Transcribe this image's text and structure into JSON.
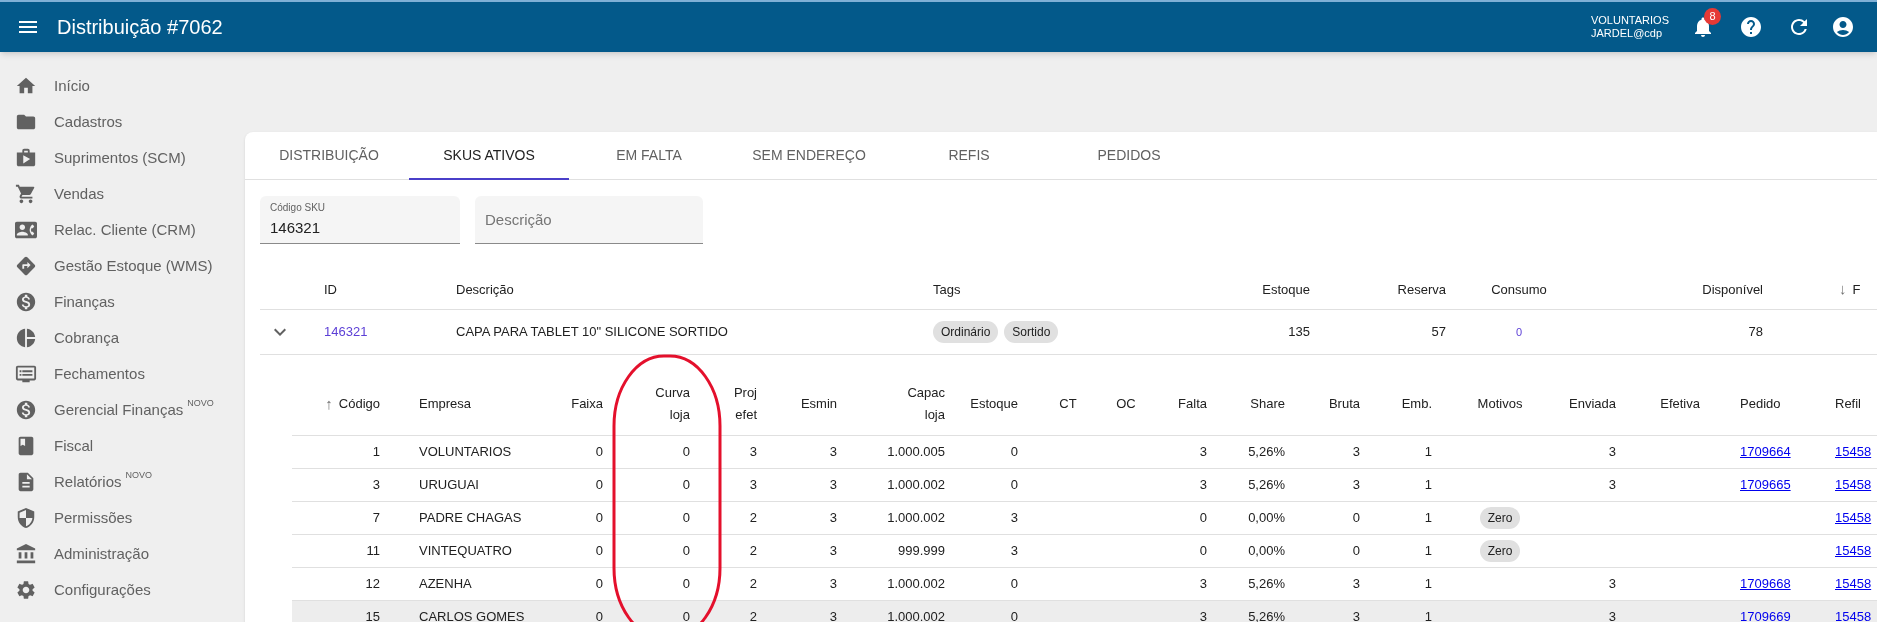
{
  "app_bar": {
    "title": "Distribuição #7062",
    "user_line_1": "VOLUNTARIOS",
    "user_line_2": "JARDEL@cdp",
    "notifications": "8"
  },
  "sidebar": {
    "items": [
      {
        "label": "Início"
      },
      {
        "label": "Cadastros"
      },
      {
        "label": "Suprimentos (SCM)"
      },
      {
        "label": "Vendas"
      },
      {
        "label": "Relac. Cliente (CRM)"
      },
      {
        "label": "Gestão Estoque (WMS)"
      },
      {
        "label": "Finanças"
      },
      {
        "label": "Cobrança"
      },
      {
        "label": "Fechamentos"
      },
      {
        "label": "Gerencial Finanças",
        "badge": "NOVO"
      },
      {
        "label": "Fiscal"
      },
      {
        "label": "Relatórios",
        "badge": "NOVO"
      },
      {
        "label": "Permissões"
      },
      {
        "label": "Administração"
      },
      {
        "label": "Configurações"
      }
    ]
  },
  "tabs": [
    {
      "label": "DISTRIBUIÇÃO",
      "selected": false
    },
    {
      "label": "SKUS ATIVOS",
      "selected": true
    },
    {
      "label": "EM FALTA",
      "selected": false
    },
    {
      "label": "SEM ENDEREÇO",
      "selected": false
    },
    {
      "label": "REFIS",
      "selected": false
    },
    {
      "label": "PEDIDOS",
      "selected": false
    }
  ],
  "filters": [
    {
      "label": "Código SKU",
      "value": "146321"
    },
    {
      "placeholder": "Descrição"
    }
  ],
  "sku_table": {
    "columns": [
      {
        "label": "ID"
      },
      {
        "label": "Descrição"
      },
      {
        "label": "Tags"
      },
      {
        "label": "Estoque"
      },
      {
        "label": "Reserva"
      },
      {
        "label": "Consumo"
      },
      {
        "label": "Disponível"
      },
      {
        "label": "F",
        "sort_arrow": "↓"
      }
    ],
    "rows": [
      {
        "expanded": true,
        "id": "146321",
        "description": "CAPA PARA TABLET 10\" SILICONE SORTIDO",
        "tags": [
          "Ordinário",
          "Sortido"
        ],
        "estoque": "135",
        "reserva": "57",
        "consumo": "0",
        "disponivel": "78"
      }
    ]
  },
  "store_table": {
    "columns": [
      {
        "label": "Código",
        "sort_arrow": "↑"
      },
      {
        "label": "Empresa"
      },
      {
        "label": "Faixa"
      },
      {
        "label": "Curva loja"
      },
      {
        "label": "Proj efet"
      },
      {
        "label": "Esmin"
      },
      {
        "label": "Capac loja"
      },
      {
        "label": "Estoque"
      },
      {
        "label": "CT"
      },
      {
        "label": "OC"
      },
      {
        "label": "Falta"
      },
      {
        "label": "Share"
      },
      {
        "label": "Bruta"
      },
      {
        "label": "Emb."
      },
      {
        "label": "Motivos"
      },
      {
        "label": "Enviada"
      },
      {
        "label": "Efetiva"
      },
      {
        "label": "Pedido"
      },
      {
        "label": "Refil"
      }
    ],
    "rows": [
      {
        "hovered": false,
        "codigo": "1",
        "empresa": "VOLUNTARIOS",
        "faixa": "0",
        "curva_loja": "0",
        "proj_efet": "3",
        "esmin": "3",
        "capac_loja": "1.000.005",
        "estoque": "0",
        "falta": "3",
        "share": "5,26%",
        "bruta": "3",
        "emb": "1",
        "enviada": "3",
        "pedido": "1709664",
        "refil": "15458"
      },
      {
        "hovered": false,
        "codigo": "3",
        "empresa": "URUGUAI",
        "faixa": "0",
        "curva_loja": "0",
        "proj_efet": "3",
        "esmin": "3",
        "capac_loja": "1.000.002",
        "estoque": "0",
        "falta": "3",
        "share": "5,26%",
        "bruta": "3",
        "emb": "1",
        "enviada": "3",
        "pedido": "1709665",
        "refil": "15458"
      },
      {
        "hovered": false,
        "codigo": "7",
        "empresa": "PADRE CHAGAS",
        "faixa": "0",
        "curva_loja": "0",
        "proj_efet": "2",
        "esmin": "3",
        "capac_loja": "1.000.002",
        "estoque": "3",
        "falta": "0",
        "share": "0,00%",
        "bruta": "0",
        "emb": "1",
        "motivos": "Zero",
        "refil": "15458"
      },
      {
        "hovered": false,
        "codigo": "11",
        "empresa": "VINTEQUATRO",
        "faixa": "0",
        "curva_loja": "0",
        "proj_efet": "2",
        "esmin": "3",
        "capac_loja": "999.999",
        "estoque": "3",
        "falta": "0",
        "share": "0,00%",
        "bruta": "0",
        "emb": "1",
        "motivos": "Zero",
        "refil": "15458"
      },
      {
        "hovered": false,
        "codigo": "12",
        "empresa": "AZENHA",
        "faixa": "0",
        "curva_loja": "0",
        "proj_efet": "2",
        "esmin": "3",
        "capac_loja": "1.000.002",
        "estoque": "0",
        "falta": "3",
        "share": "5,26%",
        "bruta": "3",
        "emb": "1",
        "enviada": "3",
        "pedido": "1709668",
        "refil": "15458"
      },
      {
        "hovered": true,
        "codigo": "15",
        "empresa": "CARLOS GOMES",
        "faixa": "0",
        "curva_loja": "0",
        "proj_efet": "2",
        "esmin": "3",
        "capac_loja": "1.000.002",
        "estoque": "0",
        "falta": "3",
        "share": "5,26%",
        "bruta": "3",
        "emb": "1",
        "enviada": "3",
        "pedido": "1709669",
        "refil": "15458"
      }
    ]
  },
  "annotation": {
    "kind": "ellipse"
  }
}
